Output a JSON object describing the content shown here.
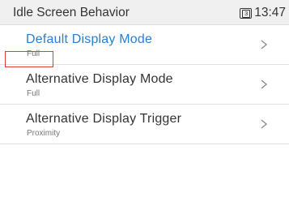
{
  "header": {
    "title": "Idle Screen Behavior",
    "line_number": "3",
    "time": "13:47"
  },
  "items": [
    {
      "label": "Default Display Mode",
      "value": "Full",
      "selected": true
    },
    {
      "label": "Alternative Display Mode",
      "value": "Full",
      "selected": false
    },
    {
      "label": "Alternative Display Trigger",
      "value": "Proximity",
      "selected": false
    }
  ],
  "colors": {
    "accent": "#2a7ed3",
    "highlight": "#e23a3a",
    "header_bg": "#f0f0f0"
  },
  "icons": {
    "status": "line-status-icon",
    "row_arrow": "chevron-right-icon"
  }
}
